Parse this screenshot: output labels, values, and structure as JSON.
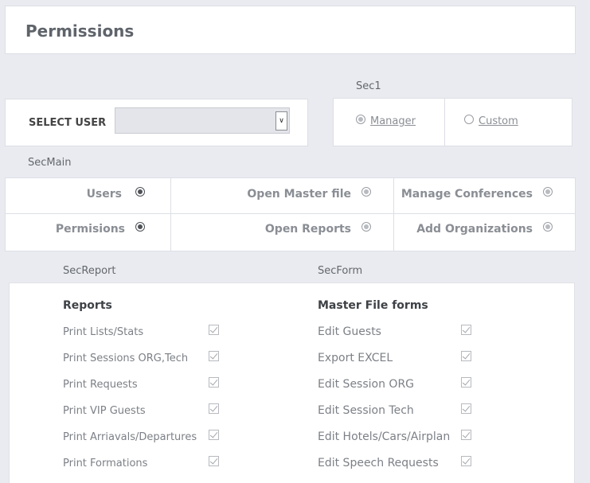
{
  "header": {
    "title": "Permissions"
  },
  "user_select": {
    "label": "SELECT USER",
    "value": ""
  },
  "sec1": {
    "caption": "Sec1",
    "options": [
      {
        "label": "Manager",
        "selected": true
      },
      {
        "label": "Custom",
        "selected": false
      }
    ]
  },
  "sec_main": {
    "caption": "SecMain",
    "items": [
      {
        "label": "Users",
        "selected": true
      },
      {
        "label": "Open Master file",
        "selected": true
      },
      {
        "label": "Manage Conferences",
        "selected": true
      },
      {
        "label": "Permisions",
        "selected": true
      },
      {
        "label": "Open Reports",
        "selected": true
      },
      {
        "label": "Add Organizations",
        "selected": true
      }
    ]
  },
  "sec_report": {
    "caption": "SecReport",
    "heading": "Reports",
    "items": [
      {
        "label": "Print Lists/Stats",
        "checked": true
      },
      {
        "label": "Print Sessions ORG,Tech",
        "checked": true
      },
      {
        "label": "Print Requests",
        "checked": true
      },
      {
        "label": "Print VIP Guests",
        "checked": true
      },
      {
        "label": "Print Arriavals/Departures",
        "checked": true
      },
      {
        "label": "Print Formations",
        "checked": true
      }
    ]
  },
  "sec_form": {
    "caption": "SecForm",
    "heading": "Master File forms",
    "items": [
      {
        "label": "Edit Guests",
        "checked": true
      },
      {
        "label": "Export EXCEL",
        "checked": true
      },
      {
        "label": "Edit Session ORG",
        "checked": true
      },
      {
        "label": "Edit Session Tech",
        "checked": true
      },
      {
        "label": "Edit Hotels/Cars/Airplan",
        "checked": true
      },
      {
        "label": "Edit Speech Requests",
        "checked": true
      }
    ]
  }
}
